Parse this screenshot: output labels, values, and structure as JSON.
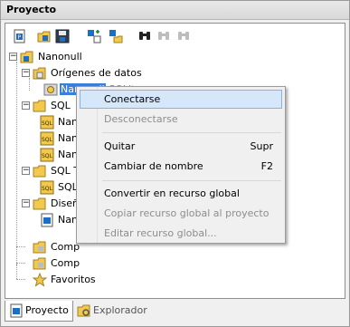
{
  "window": {
    "title": "Proyecto"
  },
  "toolbar": {
    "buttons": [
      {
        "icon": "new-project-icon"
      },
      {
        "icon": "open-project-icon"
      },
      {
        "icon": "save-project-icon"
      },
      {
        "icon": "add-files-icon"
      },
      {
        "icon": "add-folder-icon"
      },
      {
        "icon": "find-icon"
      },
      {
        "icon": "find-next-icon"
      },
      {
        "icon": "find-previous-icon"
      }
    ]
  },
  "tree": {
    "root": "Nanonull",
    "origenes": "Orígenes de datos",
    "connection": "Nanonull",
    "connection_type": "SQLite",
    "sql_folder": "SQL",
    "sql_item_1": "Nan",
    "sql_item_2": "Nan",
    "sql_item_3": "Nan",
    "sql_t_folder": "SQL T",
    "sql_t_item": "SQL",
    "diseno_folder": "Diseñ",
    "diseno_item": "Nan",
    "comp_1": "Comp",
    "comp_2": "Comp",
    "favoritos": "Favoritos"
  },
  "context_menu": {
    "conectarse": "Conectarse",
    "desconectarse": "Desconectarse",
    "quitar": "Quitar",
    "quitar_shortcut": "Supr",
    "cambiar_nombre": "Cambiar de nombre",
    "cambiar_nombre_shortcut": "F2",
    "convertir_global": "Convertir en recurso global",
    "copiar_global": "Copiar recurso global al proyecto",
    "editar_global": "Editar recurso global..."
  },
  "tabs": {
    "proyecto": "Proyecto",
    "explorador": "Explorador"
  },
  "colors": {
    "selection": "#3c7fd8",
    "menu_hover": "#d5e7f8",
    "folder": "#f2c94c"
  }
}
